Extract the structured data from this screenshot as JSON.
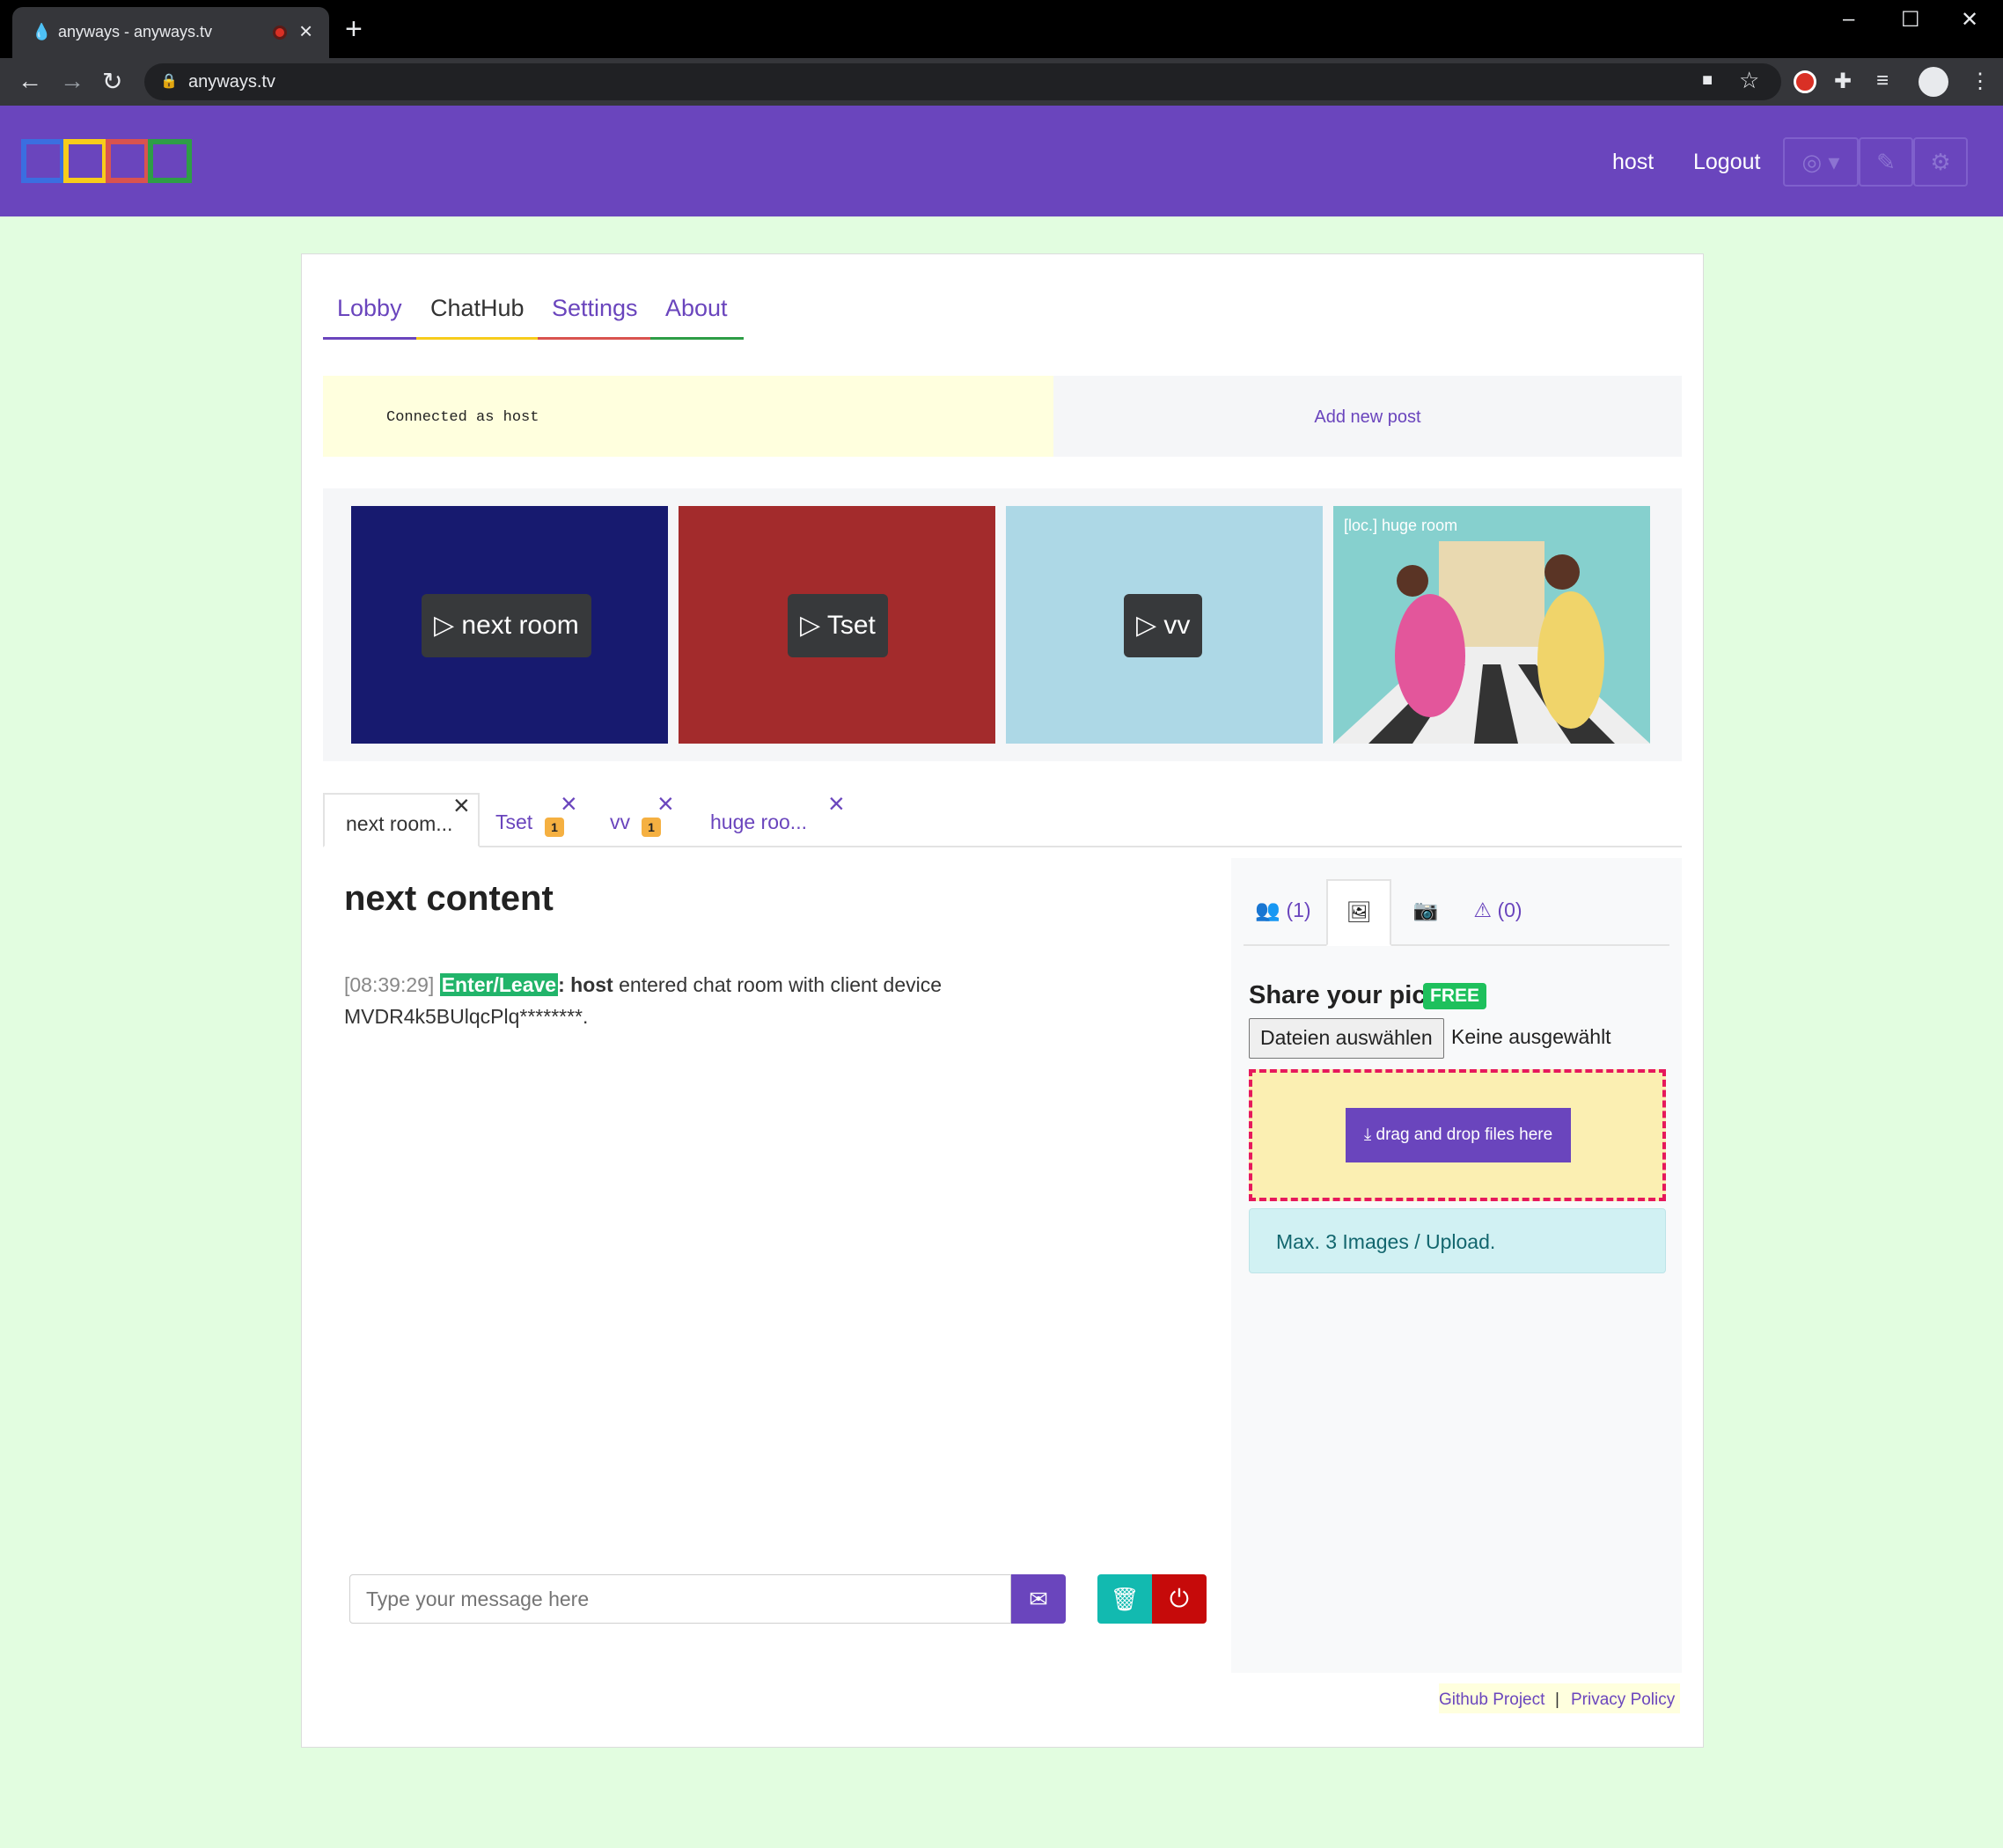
{
  "browser": {
    "tab_title": "anyways - anyways.tv",
    "url": "anyways.tv"
  },
  "header": {
    "nav": [
      "host",
      "Logout"
    ],
    "logo_colors": [
      "#3b6ee0",
      "#f7cc1b",
      "#d9534f",
      "#2e9d46"
    ],
    "brand_color": "#6a45bd"
  },
  "main_tabs": [
    "Lobby",
    "ChatHub",
    "Settings",
    "About"
  ],
  "status": {
    "connected_text": "Connected as host",
    "add_post": "Add new post"
  },
  "rooms": [
    {
      "label": "next room",
      "color": "#171a6f"
    },
    {
      "label": "Tset",
      "color": "#a32b2c"
    },
    {
      "label": "vv",
      "color": "#add8e6"
    },
    {
      "label": "[loc.] huge room"
    }
  ],
  "room_tabs": [
    {
      "label": "next room...",
      "badge": ""
    },
    {
      "label": "Tset",
      "badge": "1"
    },
    {
      "label": "vv",
      "badge": "1"
    },
    {
      "label": "huge roo...",
      "badge": ""
    }
  ],
  "chat": {
    "title": "next content",
    "message": {
      "time": "[08:39:29]",
      "tag": "Enter/Leave",
      "sep": ":",
      "user": "host",
      "text": "entered chat room with client device MVDR4k5BUlqcPlq********."
    },
    "input_placeholder": "Type your message here"
  },
  "side": {
    "users_count": "(1)",
    "alerts_count": "(0)",
    "share_title": "Share your pics",
    "free_badge": "FREE",
    "file_button": "Dateien auswählen",
    "file_none": "Keine ausgewählt",
    "drop_label": "drag and drop files here",
    "max_info": "Max. 3 Images / Upload."
  },
  "footer": {
    "github": "Github Project",
    "sep": "|",
    "privacy": "Privacy Policy"
  }
}
